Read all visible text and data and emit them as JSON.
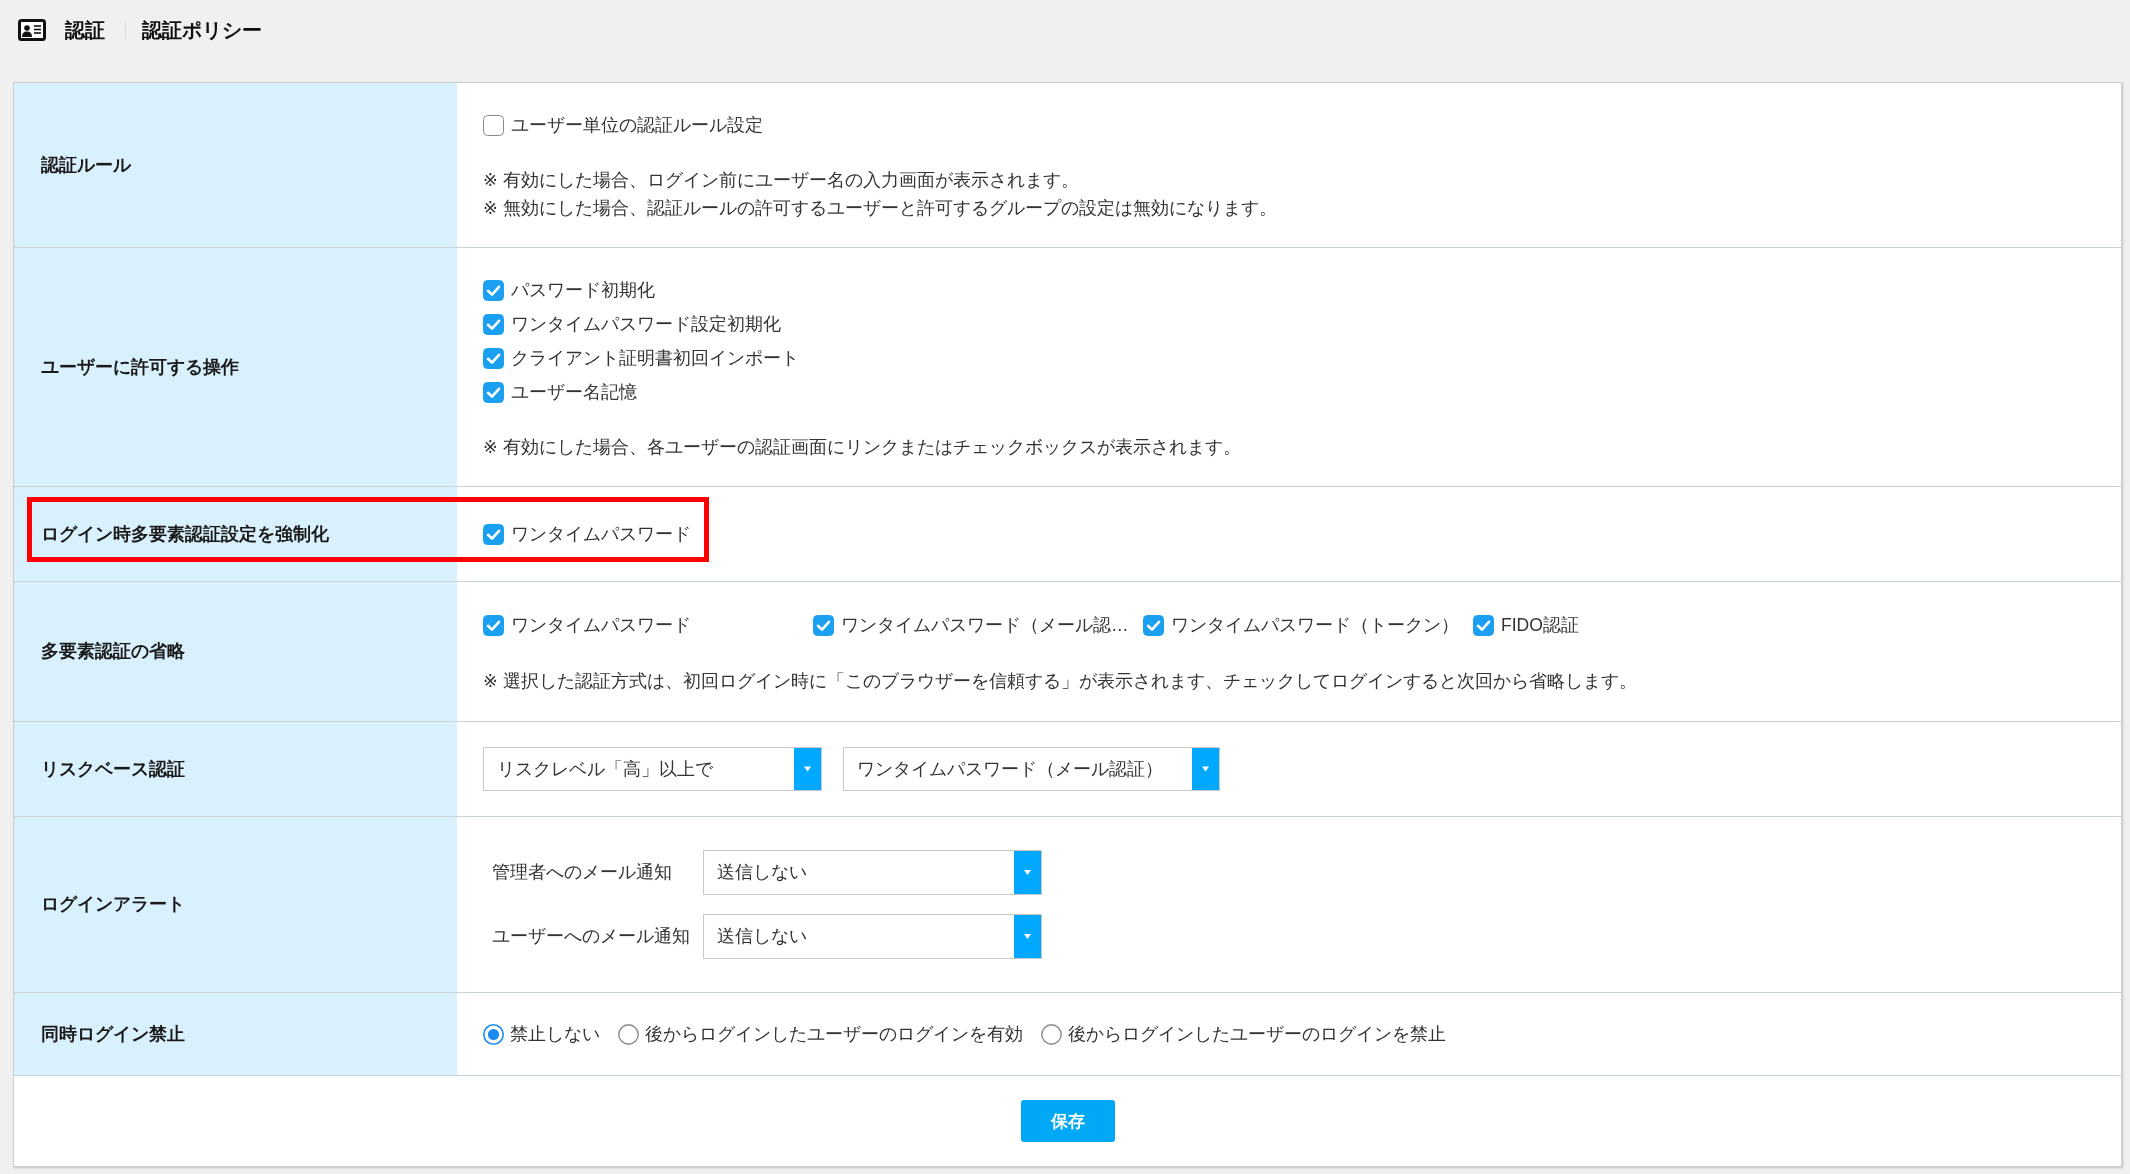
{
  "header": {
    "section": "認証",
    "page": "認証ポリシー"
  },
  "rows": [
    {
      "kind": "checklist",
      "label": "認証ルール",
      "highlighted": false,
      "options": [
        {
          "label": "ユーザー単位の認証ルール設定",
          "checked": false
        }
      ],
      "notes": [
        "※ 有効にした場合、ログイン前にユーザー名の入力画面が表示されます。",
        "※ 無効にした場合、認証ルールの許可するユーザーと許可するグループの設定は無効になります。"
      ]
    },
    {
      "kind": "checklist",
      "label": "ユーザーに許可する操作",
      "highlighted": false,
      "options": [
        {
          "label": "パスワード初期化",
          "checked": true
        },
        {
          "label": "ワンタイムパスワード設定初期化",
          "checked": true
        },
        {
          "label": "クライアント証明書初回インポート",
          "checked": true
        },
        {
          "label": "ユーザー名記憶",
          "checked": true
        }
      ],
      "notes": [
        "※ 有効にした場合、各ユーザーの認証画面にリンクまたはチェックボックスが表示されます。"
      ]
    },
    {
      "kind": "checklist",
      "label": "ログイン時多要素認証設定を強制化",
      "highlighted": true,
      "options": [
        {
          "label": "ワンタイムパスワード",
          "checked": true
        }
      ]
    },
    {
      "kind": "inline_checks",
      "label": "多要素認証の省略",
      "highlighted": false,
      "options": [
        {
          "label": "ワンタイムパスワード",
          "checked": true
        },
        {
          "label": "ワンタイムパスワード（メール認…",
          "checked": true
        },
        {
          "label": "ワンタイムパスワード（トークン）",
          "checked": true
        },
        {
          "label": "FIDO認証",
          "checked": true
        }
      ],
      "notes": [
        "※ 選択した認証方式は、初回ログイン時に「このブラウザーを信頼する」が表示されます、チェックしてログインすると次回から省略します。"
      ]
    },
    {
      "kind": "selects",
      "label": "リスクベース認証",
      "highlighted": false,
      "selects": [
        {
          "value": "リスクレベル「高」以上で"
        },
        {
          "value": "ワンタイムパスワード（メール認証）"
        }
      ]
    },
    {
      "kind": "labeled_selects",
      "label": "ログインアラート",
      "highlighted": false,
      "selects": [
        {
          "label": "管理者へのメール通知",
          "value": "送信しない"
        },
        {
          "label": "ユーザーへのメール通知",
          "value": "送信しない"
        }
      ]
    },
    {
      "kind": "radios",
      "label": "同時ログイン禁止",
      "highlighted": false,
      "options": [
        {
          "label": "禁止しない",
          "selected": true
        },
        {
          "label": "後からログインしたユーザーのログインを有効",
          "selected": false
        },
        {
          "label": "後からログインしたユーザーのログインを禁止",
          "selected": false
        }
      ]
    }
  ],
  "save_button": "保存"
}
